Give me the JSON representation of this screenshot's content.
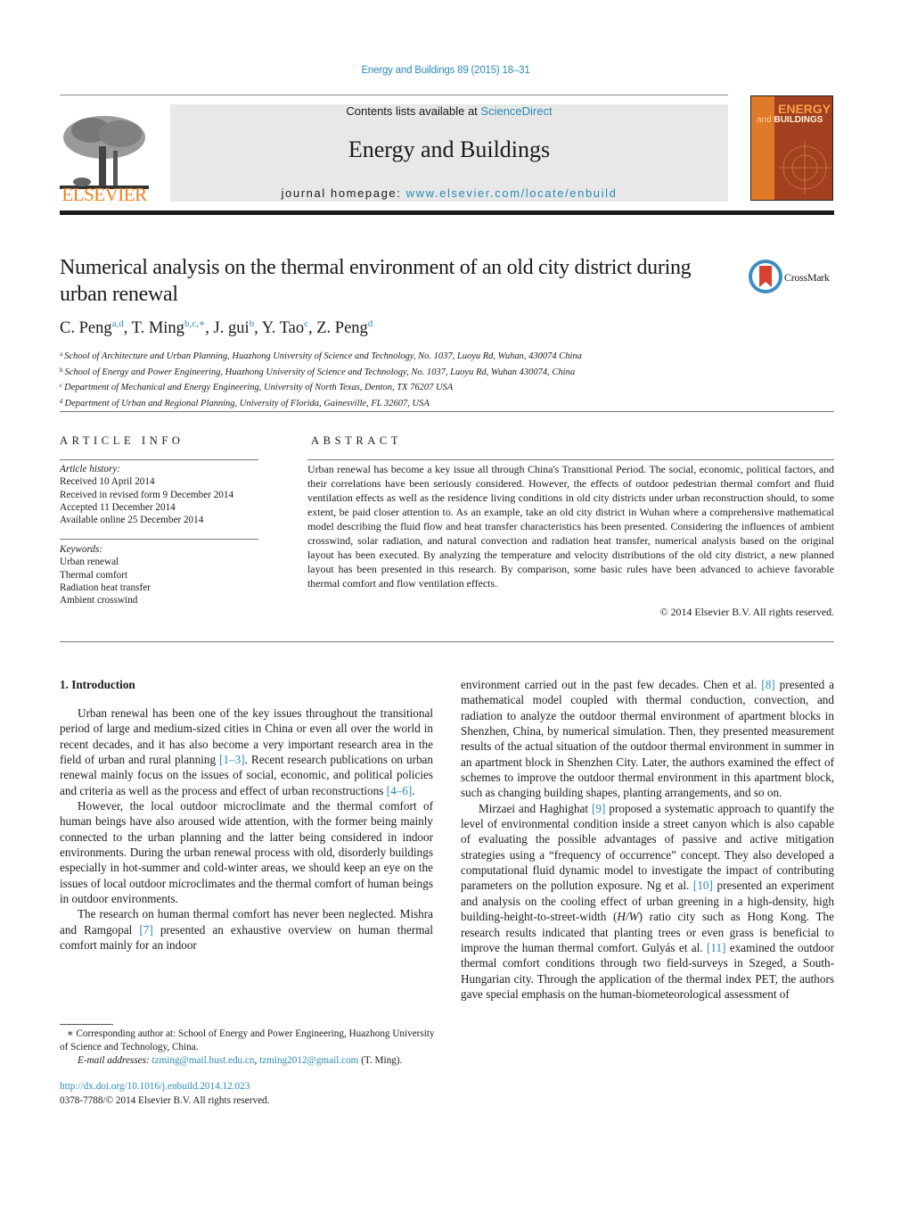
{
  "header": {
    "journal_ref": "Energy and Buildings 89 (2015) 18–31",
    "contents_prefix": "Contents lists available at ",
    "contents_link": "ScienceDirect",
    "journal_title": "Energy and Buildings",
    "homepage_prefix": "journal homepage: ",
    "homepage_link": "www.elsevier.com/locate/enbuild",
    "publisher_logo": "ELSEVIER",
    "cover_title_1": "ENERGY",
    "cover_title_and": "and",
    "cover_title_2": "BUILDINGS",
    "crossmark_label": "CrossMark"
  },
  "article": {
    "title": "Numerical analysis on the thermal environment of an old city district during urban renewal",
    "authors": [
      {
        "name": "C. Peng",
        "sup": "a,d"
      },
      {
        "name": "T. Ming",
        "sup": "b,c,∗"
      },
      {
        "name": "J. gui",
        "sup": "b"
      },
      {
        "name": "Y. Tao",
        "sup": "c"
      },
      {
        "name": "Z. Peng",
        "sup": "d"
      }
    ],
    "affiliations": [
      {
        "key": "a",
        "text": "School of Architecture and Urban Planning, Huazhong University of Science and Technology, No. 1037, Luoyu Rd, Wuhan, 430074 China"
      },
      {
        "key": "b",
        "text": "School of Energy and Power Engineering, Huazhong University of Science and Technology, No. 1037, Luoyu Rd, Wuhan 430074, China"
      },
      {
        "key": "c",
        "text": "Department of Mechanical and Energy Engineering, University of North Texas, Denton, TX 76207 USA"
      },
      {
        "key": "d",
        "text": "Department of Urban and Regional Planning, University of Florida, Gainesville, FL 32607, USA"
      }
    ]
  },
  "article_info": {
    "heading": "ARTICLE INFO",
    "history_label": "Article history:",
    "history": [
      "Received 10 April 2014",
      "Received in revised form 9 December 2014",
      "Accepted 11 December 2014",
      "Available online 25 December 2014"
    ],
    "keywords_label": "Keywords:",
    "keywords": [
      "Urban renewal",
      "Thermal comfort",
      "Radiation heat transfer",
      "Ambient crosswind"
    ]
  },
  "abstract": {
    "heading": "ABSTRACT",
    "text": "Urban renewal has become a key issue all through China's Transitional Period. The social, economic, political factors, and their correlations have been seriously considered. However, the effects of outdoor pedestrian thermal comfort and fluid ventilation effects as well as the residence living conditions in old city districts under urban reconstruction should, to some extent, be paid closer attention to. As an example, take an old city district in Wuhan where a comprehensive mathematical model describing the fluid flow and heat transfer characteristics has been presented. Considering the influences of ambient crosswind, solar radiation, and natural convection and radiation heat transfer, numerical analysis based on the original layout has been executed. By analyzing the temperature and velocity distributions of the old city district, a new planned layout has been presented in this research. By comparison, some basic rules have been advanced to achieve favorable thermal comfort and flow ventilation effects.",
    "copyright": "© 2014 Elsevier B.V. All rights reserved."
  },
  "body": {
    "section_heading": "1.  Introduction",
    "left": {
      "p1_a": "Urban renewal has been one of the key issues throughout the transitional period of large and medium-sized cities in China or even all over the world in recent decades, and it has also become a very important research area in the field of urban and rural planning ",
      "p1_ref1": "[1–3]",
      "p1_b": ". Recent research publications on urban renewal mainly focus on the issues of social, economic, and political policies and criteria as well as the process and effect of urban reconstructions ",
      "p1_ref2": "[4–6]",
      "p1_c": ".",
      "p2": "However, the local outdoor microclimate and the thermal comfort of human beings have also aroused wide attention, with the former being mainly connected to the urban planning and the latter being considered in indoor environments. During the urban renewal process with old, disorderly buildings especially in hot-summer and cold-winter areas, we should keep an eye on the issues of local outdoor microclimates and the thermal comfort of human beings in outdoor environments.",
      "p3_a": "The research on human thermal comfort has never been neglected. Mishra and Ramgopal ",
      "p3_ref": "[7]",
      "p3_b": " presented an exhaustive overview on human thermal comfort mainly for an indoor"
    },
    "right": {
      "p1_a": "environment carried out in the past few decades. Chen et al. ",
      "p1_ref": "[8]",
      "p1_b": " presented a mathematical model coupled with thermal conduction, convection, and radiation to analyze the outdoor thermal environment of apartment blocks in Shenzhen, China, by numerical simulation. Then, they presented measurement results of the actual situation of the outdoor thermal environment in summer in an apartment block in Shenzhen City. Later, the authors examined the effect of schemes to improve the outdoor thermal environment in this apartment block, such as changing building shapes, planting arrangements, and so on.",
      "p2_a": "Mirzaei and Haghighat ",
      "p2_ref1": "[9]",
      "p2_b": " proposed a systematic approach to quantify the level of environmental condition inside a street canyon which is also capable of evaluating the possible advantages of passive and active mitigation strategies using a “frequency of occurrence” concept. They also developed a computational fluid dynamic model to investigate the impact of contributing parameters on the pollution exposure. Ng et al. ",
      "p2_ref2": "[10]",
      "p2_c": " presented an experiment and analysis on the cooling effect of urban greening in a high-density, high building-height-to-street-width (",
      "p2_hw": "H/W",
      "p2_d": ") ratio city such as Hong Kong. The research results indicated that planting trees or even grass is beneficial to improve the human thermal comfort. Gulyás et al. ",
      "p2_ref3": "[11]",
      "p2_e": " examined the outdoor thermal comfort conditions through two field-surveys in Szeged, a South-Hungarian city. Through the application of the thermal index PET, the authors gave special emphasis on the human-biometeorological assessment of"
    }
  },
  "footnotes": {
    "corresponding": "∗  Corresponding author at: School of Energy and Power Engineering, Huazhong University of Science and Technology, China.",
    "email_label": "E-mail addresses: ",
    "email_1": "tzming@mail.hust.edu.cn",
    "email_sep": ", ",
    "email_2": "tzming2012@gmail.com",
    "email_suffix": " (T. Ming).",
    "doi": "http://dx.doi.org/10.1016/j.enbuild.2014.12.023",
    "issn": "0378-7788/© 2014 Elsevier B.V. All rights reserved."
  }
}
